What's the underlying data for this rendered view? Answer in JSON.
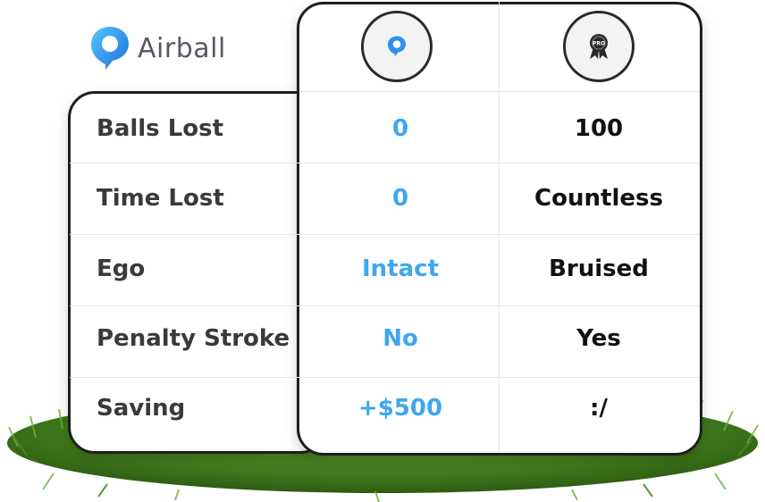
{
  "brand": {
    "name": "Airball",
    "accent": "#3ea7ef",
    "dark": "#111111"
  },
  "columns": [
    {
      "icon": "airball-logo-icon"
    },
    {
      "icon": "pro-ribbon-icon"
    }
  ],
  "rows": [
    {
      "label": "Balls Lost",
      "airball": "0",
      "other": "100"
    },
    {
      "label": "Time Lost",
      "airball": "0",
      "other": "Countless"
    },
    {
      "label": "Ego",
      "airball": "Intact",
      "other": "Bruised"
    },
    {
      "label": "Penalty Stroke",
      "airball": "No",
      "other": "Yes"
    },
    {
      "label": "Saving",
      "airball": "+$500",
      "other": ":/"
    }
  ]
}
